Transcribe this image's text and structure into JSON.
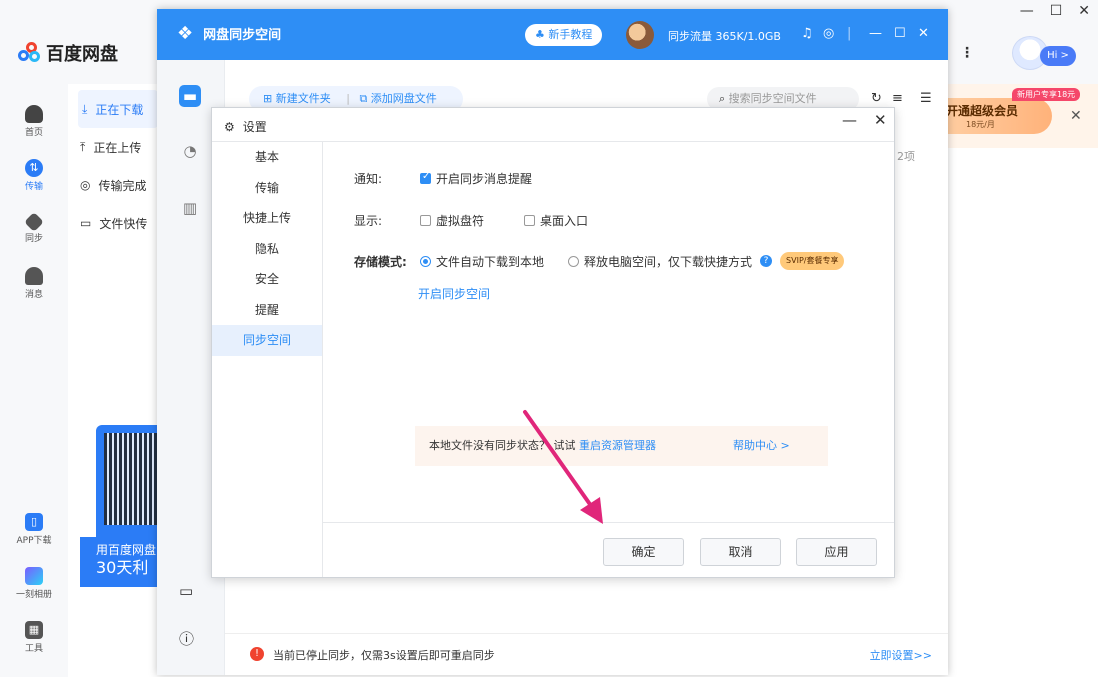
{
  "main_app": {
    "logo_text": "百度网盘",
    "nav": [
      {
        "label": "首页",
        "icon": "cloud-icon",
        "color": "#555555"
      },
      {
        "label": "传输",
        "icon": "transfer-icon",
        "color": "#2b7cf6"
      },
      {
        "label": "同步",
        "icon": "sync-icon",
        "color": "#555555"
      },
      {
        "label": "消息",
        "icon": "message-icon",
        "color": "#555555"
      }
    ],
    "nav_bottom": [
      {
        "label": "APP下载",
        "icon": "phone-icon"
      },
      {
        "label": "一刻相册",
        "icon": "album-icon"
      },
      {
        "label": "工具",
        "icon": "tools-icon"
      }
    ],
    "list": [
      {
        "label": "正在下载",
        "icon": "download-icon"
      },
      {
        "label": "正在上传",
        "icon": "upload-icon"
      },
      {
        "label": "传输完成",
        "icon": "check-circle-icon"
      },
      {
        "label": "文件快传",
        "icon": "monitor-icon"
      }
    ],
    "promo": {
      "line1": "用百度网盘",
      "line2": "30天利"
    },
    "hi_label": "Hi >",
    "vip": {
      "title": "开通超级会员",
      "price": "18元/月",
      "tag": "新用户专享18元"
    },
    "window_controls": [
      "—",
      "☐",
      "✕"
    ]
  },
  "sync_window": {
    "title": "网盘同步空间",
    "tutorial": "新手教程",
    "traffic": "同步流量  365K/1.0GB",
    "toolbar": {
      "new_folder": "新建文件夹",
      "add_files": "添加网盘文件"
    },
    "search_placeholder": "搜索同步空间文件",
    "item_count": "2项",
    "bottom_warning": "当前已停止同步，仅需3s设置后即可重启同步",
    "bottom_link": "立即设置>>"
  },
  "settings": {
    "title": "设置",
    "nav": [
      "基本",
      "传输",
      "快捷上传",
      "隐私",
      "安全",
      "提醒",
      "同步空间"
    ],
    "active_index": 6,
    "notify": {
      "label": "通知:",
      "option": "开启同步消息提醒",
      "checked": true
    },
    "display": {
      "label": "显示:",
      "option1": "虚拟盘符",
      "option2": "桌面入口"
    },
    "storage": {
      "label": "存储模式:",
      "option1": "文件自动下载到本地",
      "option2": "释放电脑空间，仅下载快捷方式",
      "badge": "SVIP/套餐专享"
    },
    "open_link": "开启同步空间",
    "notice": {
      "text": "本地文件没有同步状态？ 试试",
      "link": "重启资源管理器",
      "help": "帮助中心 >"
    },
    "buttons": {
      "ok": "确定",
      "cancel": "取消",
      "apply": "应用"
    }
  },
  "colors": {
    "accent": "#2e8ef5",
    "arrow": "#e0267a",
    "warning": "#f0432f"
  }
}
